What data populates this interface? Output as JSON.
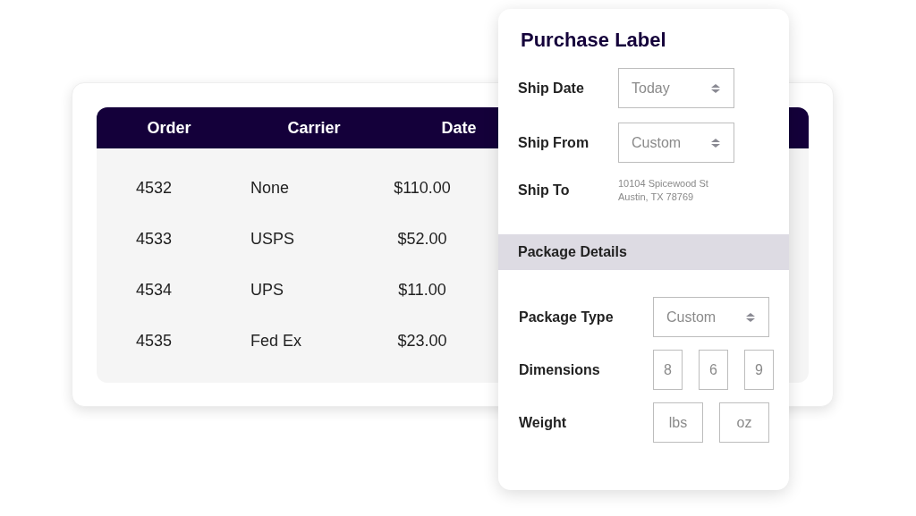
{
  "orders_table": {
    "columns": [
      "Order",
      "Carrier",
      "Date"
    ],
    "rows": [
      [
        "4532",
        "None",
        "$110.00"
      ],
      [
        "4533",
        "USPS",
        "$52.00"
      ],
      [
        "4534",
        "UPS",
        "$11.00"
      ],
      [
        "4535",
        "Fed Ex",
        "$23.00"
      ]
    ]
  },
  "purchase_label": {
    "title": "Purchase Label",
    "shipping": [
      {
        "kind": "select",
        "label": "Ship Date",
        "value": "Today"
      },
      {
        "kind": "select",
        "label": "Ship From",
        "value": "Custom"
      },
      {
        "kind": "address",
        "label": "Ship To",
        "lines": [
          "10104 Spicewood St",
          "Austin, TX 78769"
        ]
      }
    ],
    "section_title": "Package Details",
    "package": [
      {
        "kind": "select",
        "label": "Package Type",
        "value": "Custom"
      },
      {
        "kind": "inputs",
        "label": "Dimensions",
        "fields": [
          {
            "value": "8"
          },
          {
            "value": "6"
          },
          {
            "value": "9"
          }
        ]
      },
      {
        "kind": "inputs",
        "label": "Weight",
        "fields": [
          {
            "placeholder": "lbs"
          },
          {
            "placeholder": "oz"
          }
        ]
      }
    ]
  }
}
